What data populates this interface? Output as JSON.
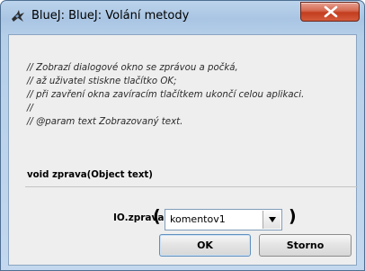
{
  "window": {
    "title": "BlueJ:  BlueJ:  Volání metody",
    "app_icon": "bluej-bird-icon",
    "close_icon": "close-icon"
  },
  "method": {
    "comment_lines": [
      "// Zobrazí dialogové okno se zprávou a počká,",
      "// až uživatel stiskne tlačítko OK;",
      "// při zavření okna zavíracím tlačítkem ukončí celou aplikaci.",
      "//",
      "// @param text   Zobrazovaný text."
    ],
    "signature": "void zprava(Object text)"
  },
  "call": {
    "label": "IO.zprava",
    "open_paren": "(",
    "close_paren": ")",
    "argument_value": "komentov1"
  },
  "buttons": {
    "ok_label": "OK",
    "cancel_label": "Storno"
  }
}
